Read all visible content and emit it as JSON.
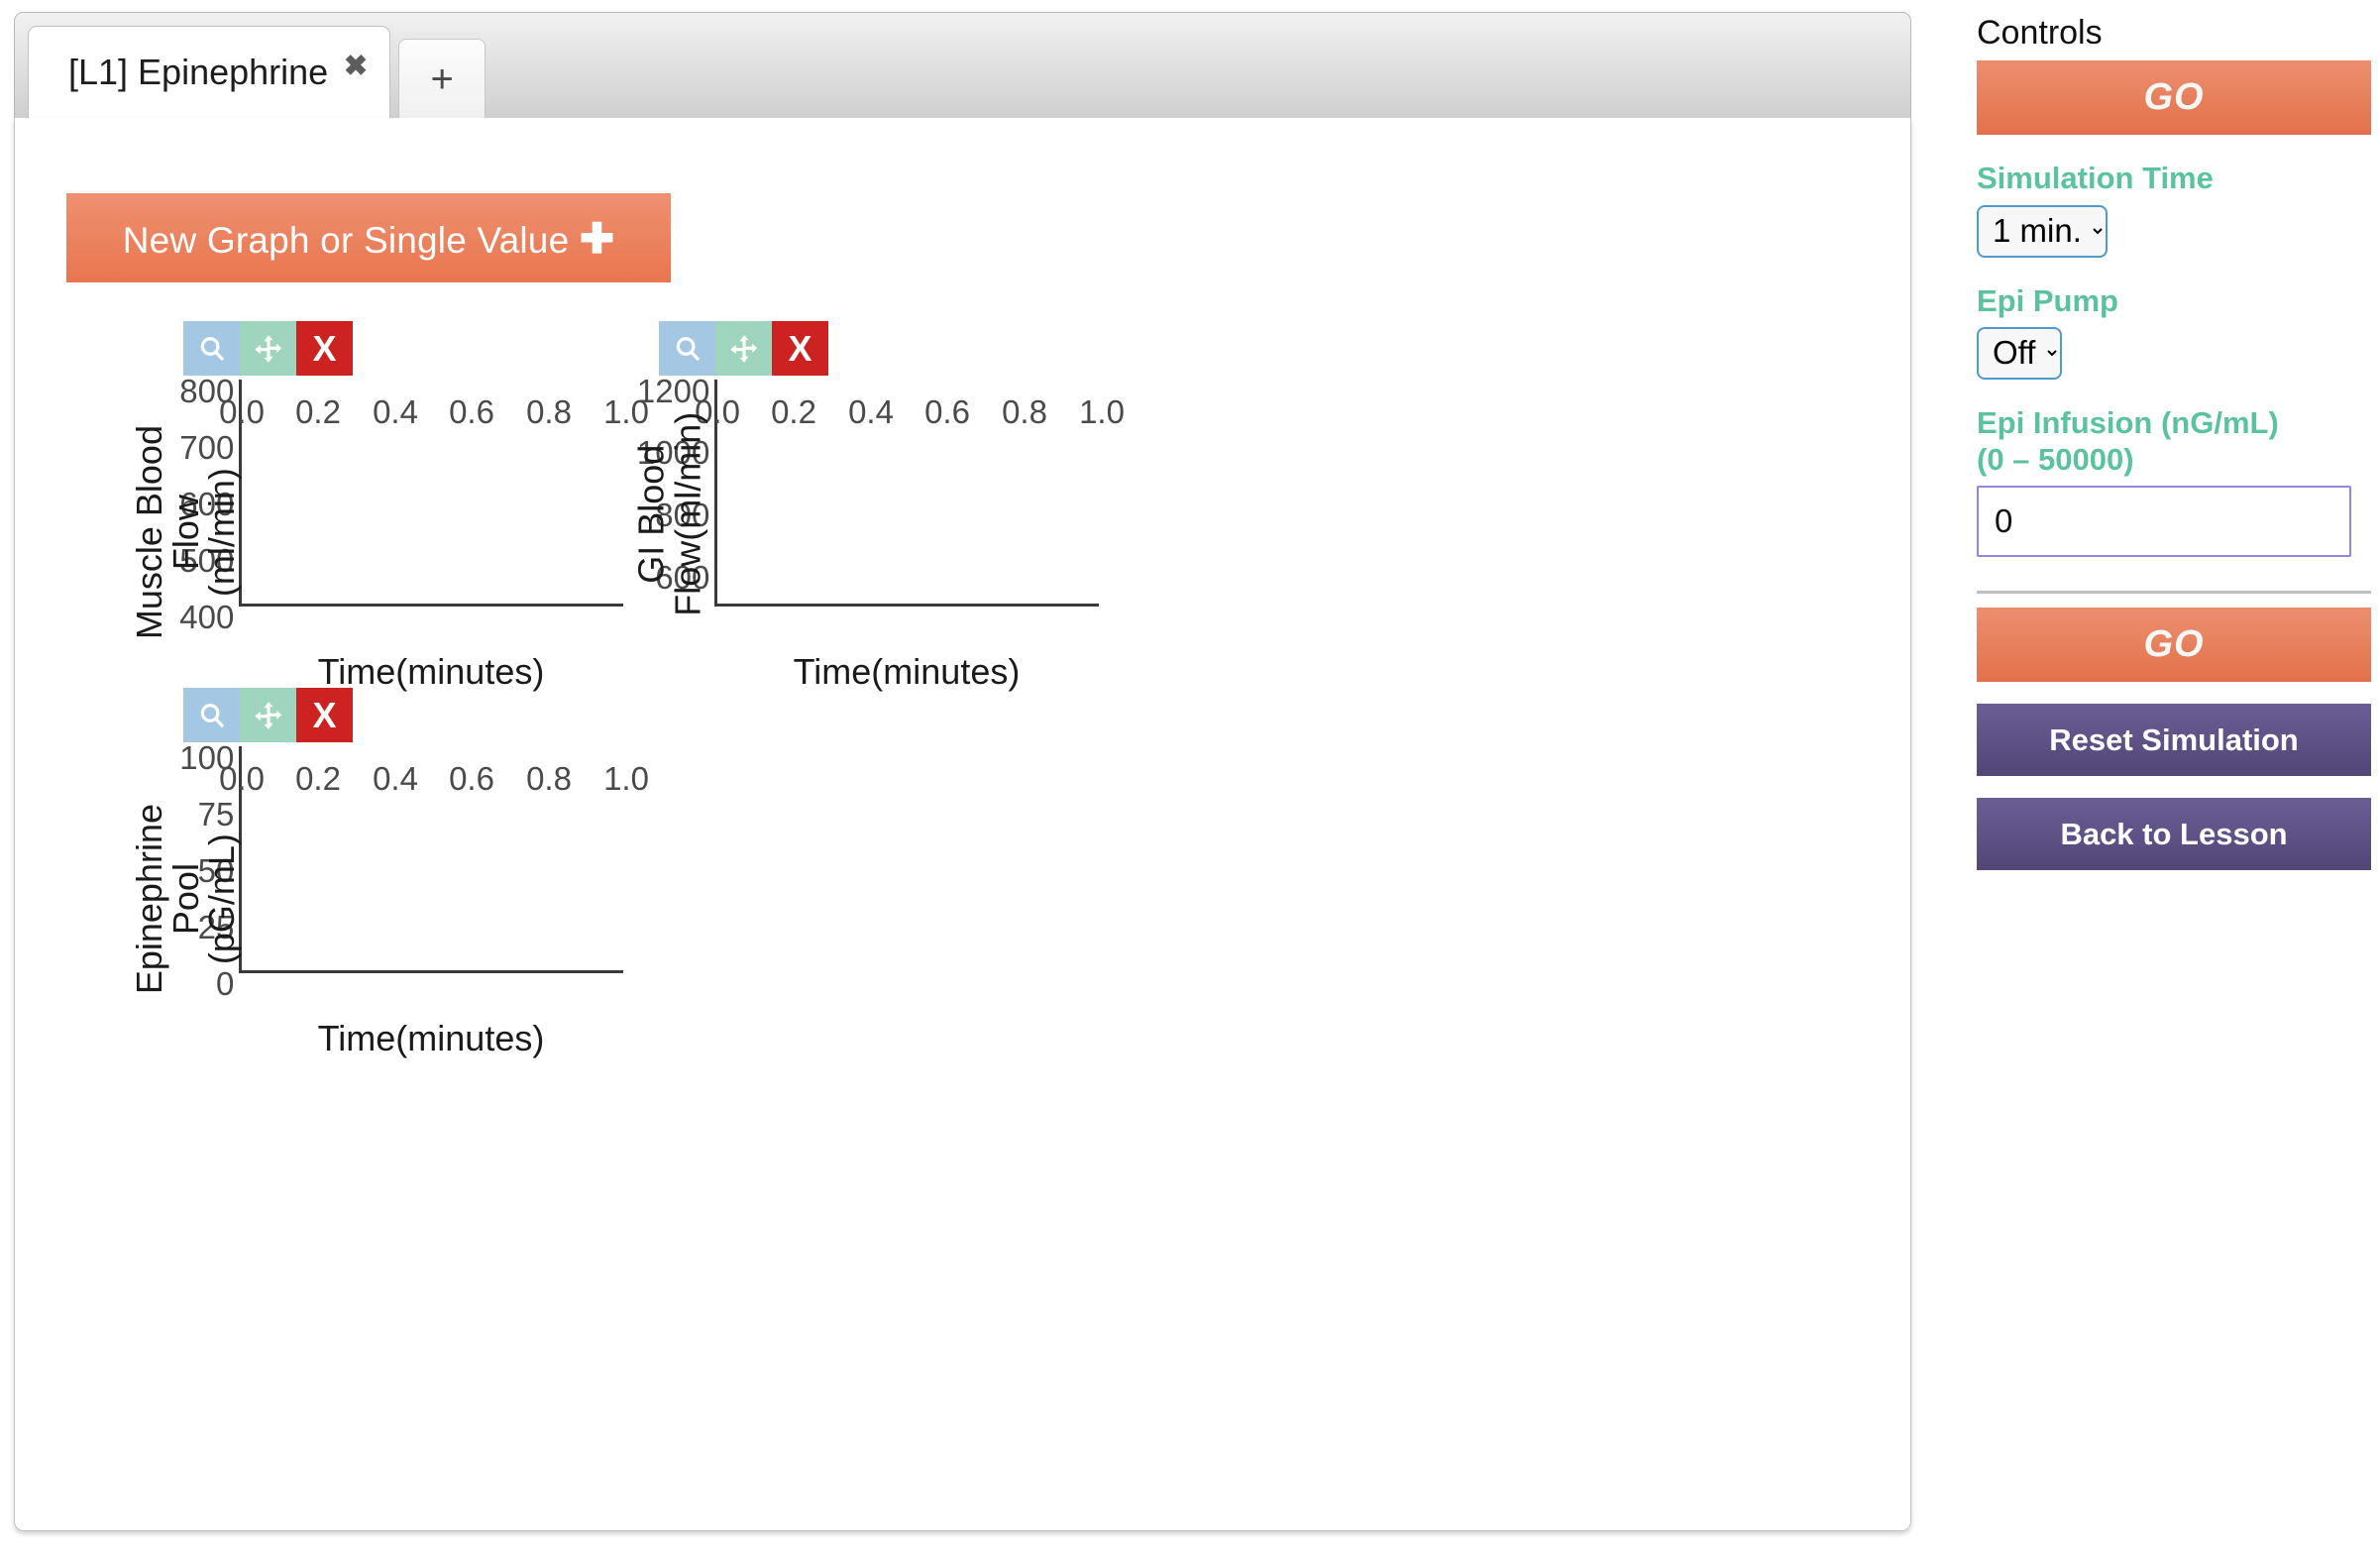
{
  "tabs": {
    "items": [
      {
        "label": "[L1] Epinephrine",
        "close": "✖"
      }
    ],
    "add_label": "+"
  },
  "toolbar": {
    "new_graph_label": "New Graph or Single Value",
    "new_graph_plus": "✚"
  },
  "chart_toolbar": {
    "zoom_label": "",
    "move_label": "",
    "close_label": "X"
  },
  "controls": {
    "title": "Controls",
    "go_top_label": "GO",
    "go_bottom_label": "GO",
    "simulation_time": {
      "label": "Simulation Time",
      "value": "1 min."
    },
    "epi_pump": {
      "label": "Epi Pump",
      "value": "Off"
    },
    "epi_infusion": {
      "label": "Epi Infusion (nG/mL)\n(0 – 50000)",
      "value": "0"
    },
    "reset_label": "Reset Simulation",
    "back_label": "Back to Lesson"
  },
  "colors": {
    "accent_orange": "#e8764f",
    "accent_teal": "#5bc2a0",
    "accent_purple": "#524677",
    "input_border": "#9287dd",
    "select_border": "#4e9ccb",
    "tb_zoom": "#a4c7e3",
    "tb_move": "#9fd4bf",
    "tb_close": "#cc2222"
  },
  "chart_data": [
    {
      "type": "line",
      "title": "",
      "ylabel": "Muscle Blood Flow\n(ml/min)",
      "xlabel": "Time(minutes)",
      "xticks": [
        "0.0",
        "0.2",
        "0.4",
        "0.6",
        "0.8",
        "1.0"
      ],
      "yticks": [
        "400",
        "500",
        "600",
        "700",
        "800"
      ],
      "xlim": [
        0.0,
        1.0
      ],
      "ylim": [
        400,
        800
      ],
      "grid": false,
      "series": [
        {
          "name": "Muscle Blood Flow",
          "x": [],
          "values": []
        }
      ]
    },
    {
      "type": "line",
      "title": "",
      "ylabel": "GI Blood\nFlow(ml/min)",
      "xlabel": "Time(minutes)",
      "xticks": [
        "0.0",
        "0.2",
        "0.4",
        "0.6",
        "0.8",
        "1.0"
      ],
      "yticks": [
        "600",
        "800",
        "1000",
        "1200"
      ],
      "xlim": [
        0.0,
        1.0
      ],
      "ylim": [
        500,
        1200
      ],
      "grid": false,
      "series": [
        {
          "name": "GI Blood Flow",
          "x": [],
          "values": []
        }
      ]
    },
    {
      "type": "line",
      "title": "",
      "ylabel": "Epinephrine Pool\n(pG/mL)",
      "xlabel": "Time(minutes)",
      "xticks": [
        "0.0",
        "0.2",
        "0.4",
        "0.6",
        "0.8",
        "1.0"
      ],
      "yticks": [
        "0",
        "25",
        "50",
        "75",
        "100"
      ],
      "xlim": [
        0.0,
        1.0
      ],
      "ylim": [
        0,
        100
      ],
      "grid": false,
      "series": [
        {
          "name": "Epinephrine Pool",
          "x": [],
          "values": []
        }
      ]
    }
  ]
}
